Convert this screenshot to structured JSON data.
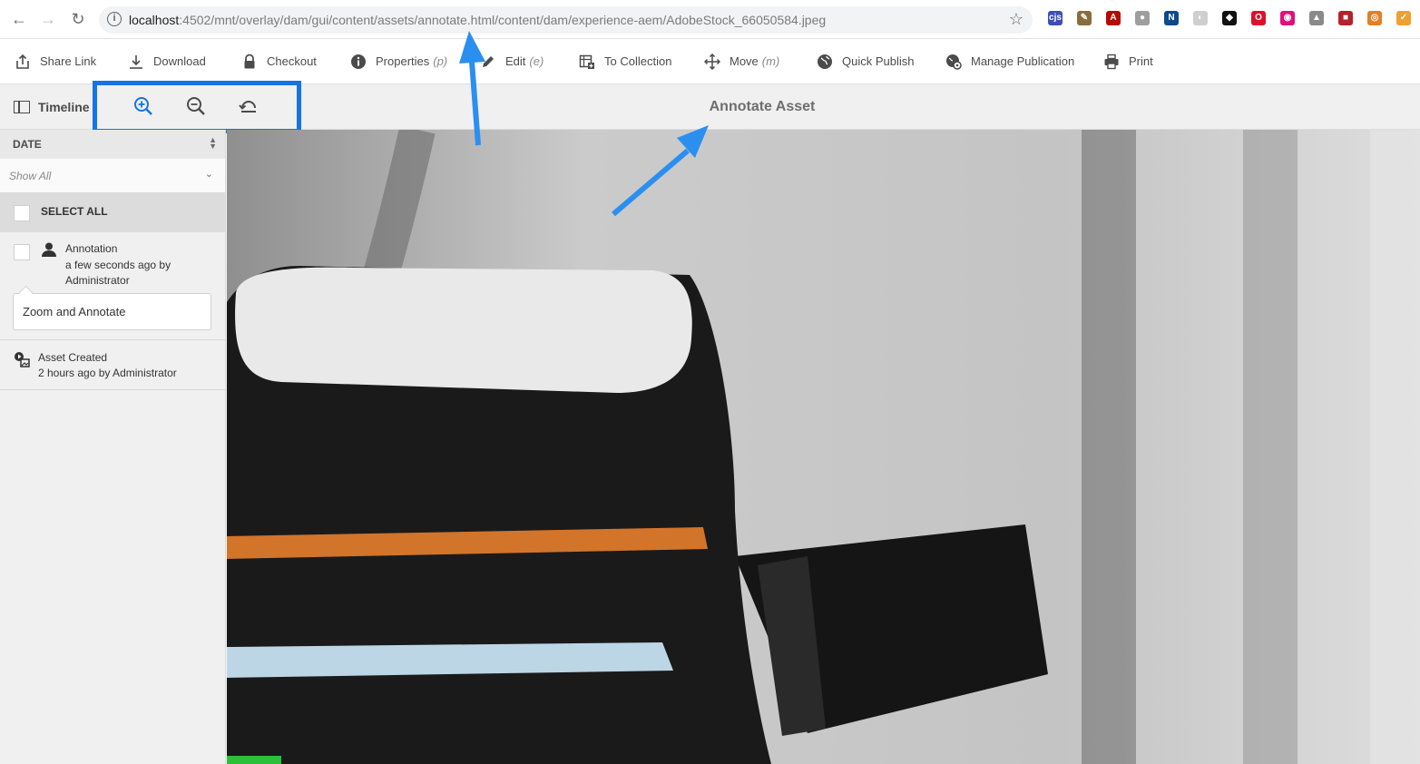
{
  "browser": {
    "url_host": "localhost",
    "url_path": ":4502/mnt/overlay/dam/gui/content/assets/annotate.html/content/dam/experience-aem/AdobeStock_66050584.jpeg",
    "extensions": [
      {
        "name": "cjs",
        "label": "cjs",
        "color": "#3b4fb8"
      },
      {
        "name": "pen-ext",
        "label": "✎",
        "color": "#8a6d3b"
      },
      {
        "name": "pdf-ext",
        "label": "A",
        "color": "#b30b00"
      },
      {
        "name": "circle-ext",
        "label": "●",
        "color": "#9e9e9e"
      },
      {
        "name": "new-ext",
        "label": "N",
        "color": "#0b4a8b"
      },
      {
        "name": "gray-ext",
        "label": "◐",
        "color": "#cfcfcf"
      },
      {
        "name": "spy-ext",
        "label": "◆",
        "color": "#111111"
      },
      {
        "name": "opera-ext",
        "label": "O",
        "color": "#e0102b"
      },
      {
        "name": "ring-ext",
        "label": "◉",
        "color": "#e0107a"
      },
      {
        "name": "drive-ext",
        "label": "▲",
        "color": "#8a8a8a"
      },
      {
        "name": "red-ext",
        "label": "■",
        "color": "#b5222a"
      },
      {
        "name": "orange-ext",
        "label": "◎",
        "color": "#e67e22"
      },
      {
        "name": "check-ext",
        "label": "✓",
        "color": "#f0a030"
      }
    ]
  },
  "actions": [
    {
      "id": "share-link",
      "label": "Share Link",
      "shortcut": ""
    },
    {
      "id": "download",
      "label": "Download",
      "shortcut": ""
    },
    {
      "id": "checkout",
      "label": "Checkout",
      "shortcut": ""
    },
    {
      "id": "properties",
      "label": "Properties",
      "shortcut": "(p)"
    },
    {
      "id": "edit",
      "label": "Edit",
      "shortcut": "(e)"
    },
    {
      "id": "to-collection",
      "label": "To Collection",
      "shortcut": ""
    },
    {
      "id": "move",
      "label": "Move",
      "shortcut": "(m)"
    },
    {
      "id": "quick-publish",
      "label": "Quick Publish",
      "shortcut": ""
    },
    {
      "id": "manage-publication",
      "label": "Manage Publication",
      "shortcut": ""
    },
    {
      "id": "print",
      "label": "Print",
      "shortcut": ""
    }
  ],
  "titlebar": {
    "timeline_label": "Timeline",
    "title": "Annotate Asset"
  },
  "sidebar": {
    "date_label": "DATE",
    "filter_label": "Show All",
    "select_all_label": "SELECT ALL",
    "annotation": {
      "title": "Annotation",
      "meta": "a few seconds ago by Administrator",
      "comment": "Zoom and Annotate"
    },
    "asset_created": {
      "title": "Asset Created",
      "meta": "2 hours ago by Administrator"
    }
  },
  "colors": {
    "highlight": "#1473e6",
    "arrow": "#2b8ff0"
  }
}
